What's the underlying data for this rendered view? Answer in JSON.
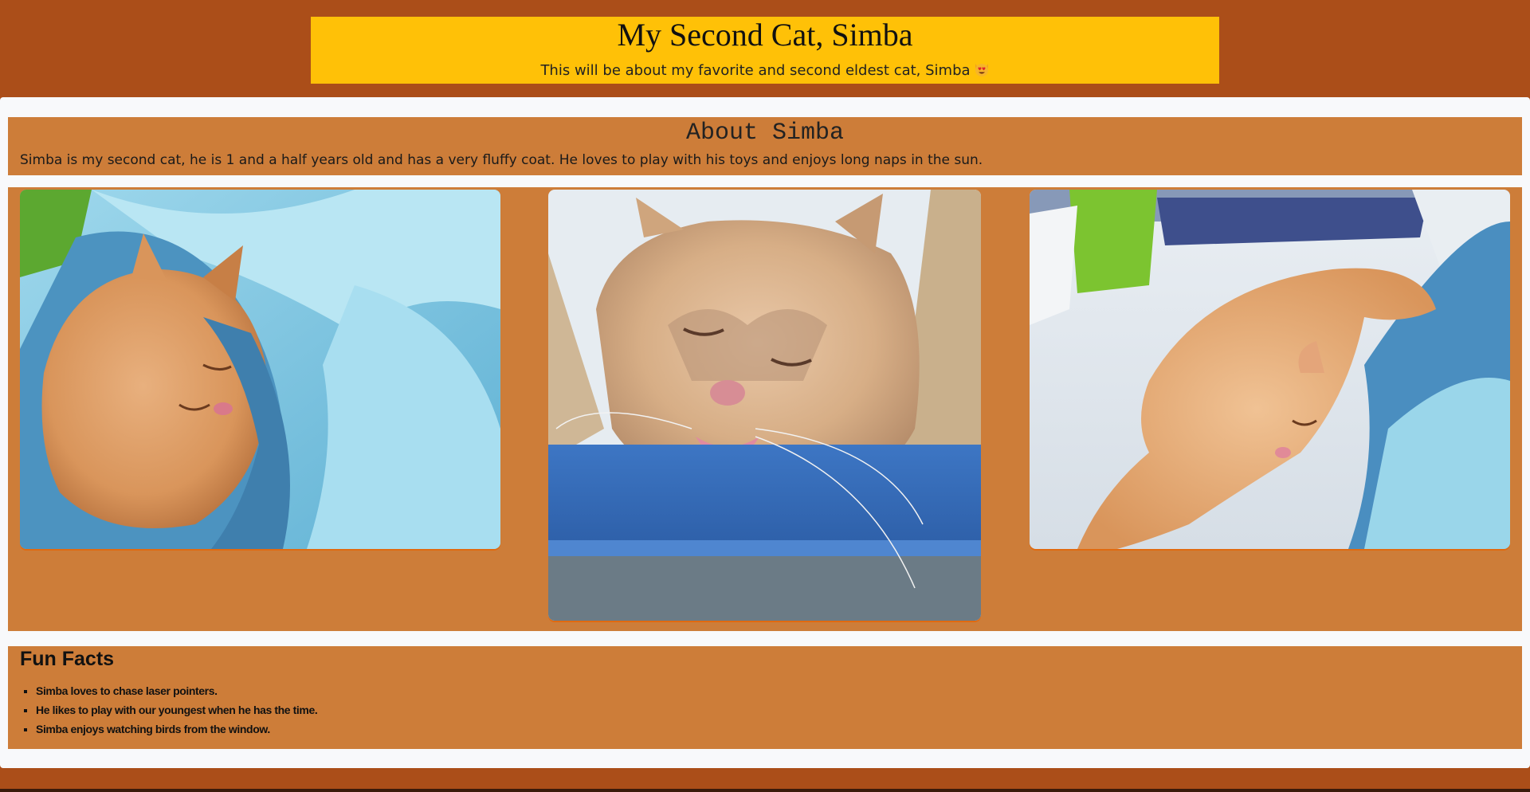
{
  "header": {
    "title": "My Second Cat, Simba",
    "subtitle": "This will be about my favorite and second eldest cat, Simba",
    "emoji_icon": "heart-eyes-cat-emoji"
  },
  "about": {
    "heading": "About Simba",
    "text": "Simba is my second cat, he is 1 and a half years old and has a very fluffy coat. He loves to play with his toys and enjoys long naps in the sun."
  },
  "gallery": {
    "photos": [
      {
        "name": "simba-sleeping-blankets-photo"
      },
      {
        "name": "simba-face-closeup-photo"
      },
      {
        "name": "simba-lying-on-bed-photo"
      }
    ]
  },
  "facts": {
    "heading": "Fun Facts",
    "items": [
      "Simba loves to chase laser pointers.",
      "He likes to play with our youngest when he has the time.",
      "Simba enjoys watching birds from the window."
    ]
  },
  "colors": {
    "page_bg": "#ab4e19",
    "header_bg": "#ffc107",
    "section_bg": "#cd7d39",
    "panel_bg": "#f8f9fb"
  }
}
